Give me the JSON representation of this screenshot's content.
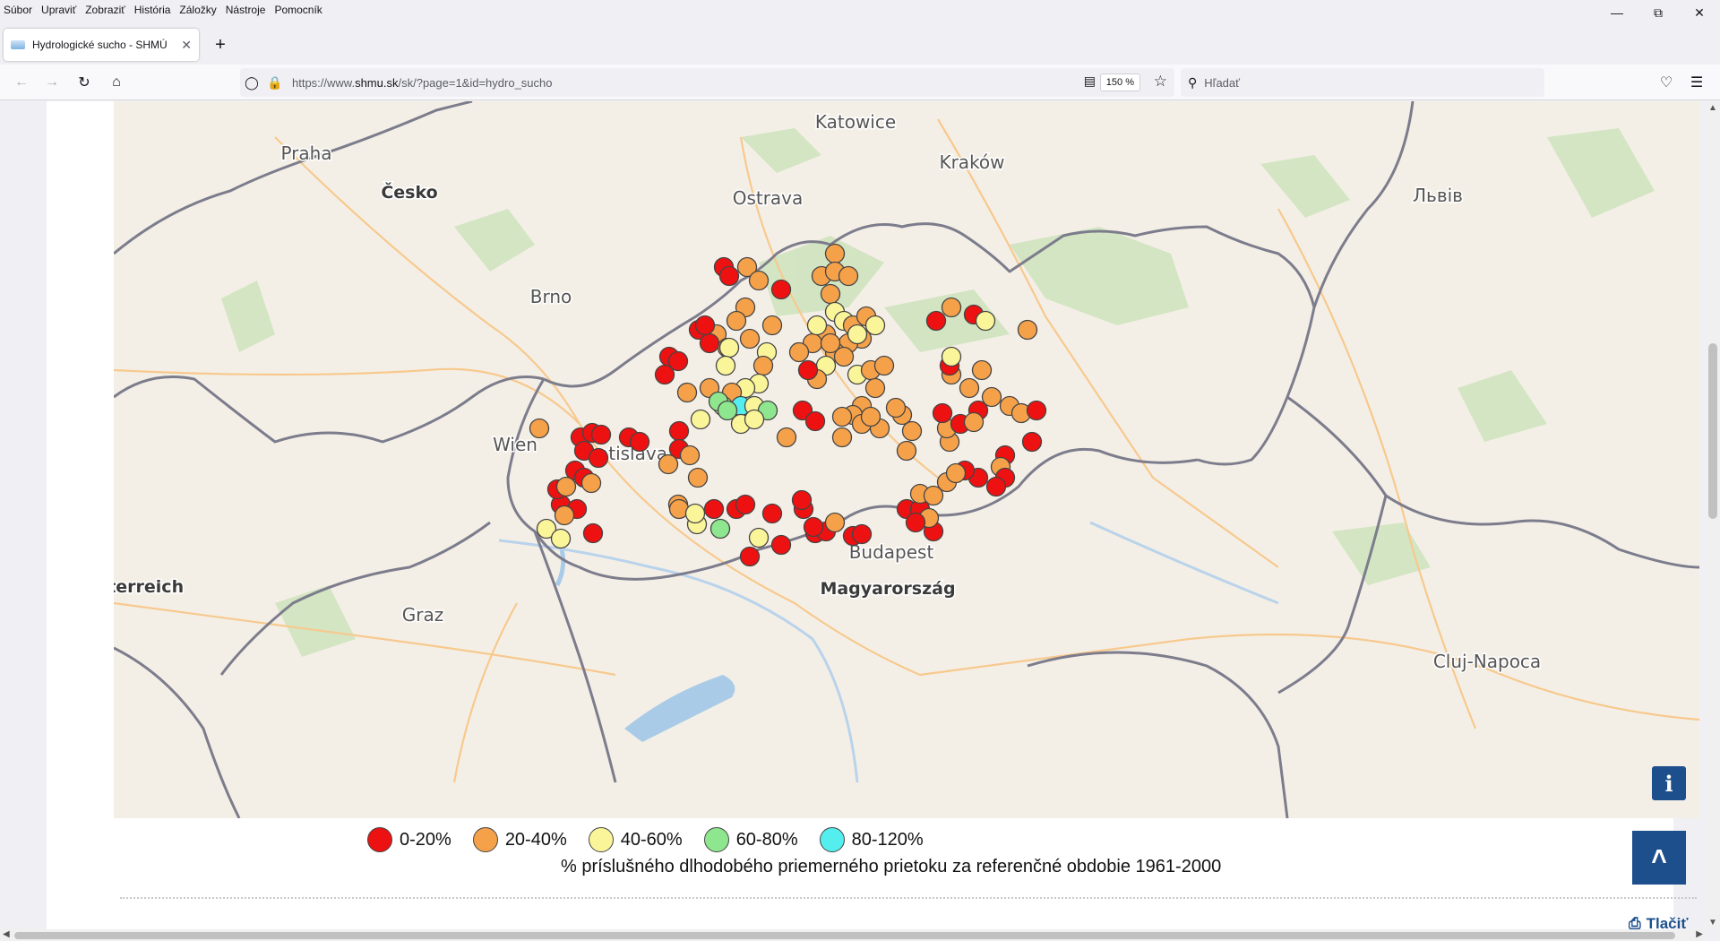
{
  "menu": [
    "Súbor",
    "Upraviť",
    "Zobraziť",
    "História",
    "Záložky",
    "Nástroje",
    "Pomocník"
  ],
  "tab": {
    "title": "Hydrologické sucho - SHMÚ"
  },
  "url": {
    "prefix": "https://www.",
    "domain": "shmu.sk",
    "path": "/sk/?page=1&id=hydro_sucho",
    "zoom": "150 %"
  },
  "search": {
    "placeholder": "Hľadať"
  },
  "map": {
    "labels": [
      {
        "text": "Katowice",
        "type": "city"
      },
      {
        "text": "Kraków",
        "type": "city"
      },
      {
        "text": "Praha",
        "type": "city"
      },
      {
        "text": "Česko",
        "type": "country"
      },
      {
        "text": "Ostrava",
        "type": "city"
      },
      {
        "text": "Львів",
        "type": "city"
      },
      {
        "text": "Brno",
        "type": "city"
      },
      {
        "text": "Wien",
        "type": "city"
      },
      {
        "text": "Bratislava",
        "type": "city"
      },
      {
        "text": "Budapest",
        "type": "city"
      },
      {
        "text": "Magyarország",
        "type": "country"
      },
      {
        "text": "sterreich",
        "type": "country"
      },
      {
        "text": "Graz",
        "type": "city"
      },
      {
        "text": "Cluj-Napoca",
        "type": "city"
      }
    ],
    "info_label": "i",
    "station_categories": [
      "0-20%",
      "20-40%",
      "40-60%",
      "60-80%",
      "80-120%"
    ]
  },
  "legend": [
    {
      "label": "0-20%",
      "color": "#ee1111"
    },
    {
      "label": "20-40%",
      "color": "#f5a14a"
    },
    {
      "label": "40-60%",
      "color": "#fbf59a"
    },
    {
      "label": "60-80%",
      "color": "#8ee68e"
    },
    {
      "label": "80-120%",
      "color": "#55eeee"
    }
  ],
  "caption": "% príslušného dlhodobého priemerného prietoku za referenčné obdobie 1961-2000",
  "print_label": "Tlačiť",
  "colors": {
    "accent": "#1c4f8c",
    "border": "#6f6f7e",
    "water": "#a9cbe8",
    "forest": "#cfe3bf",
    "land": "#f4efe6"
  }
}
